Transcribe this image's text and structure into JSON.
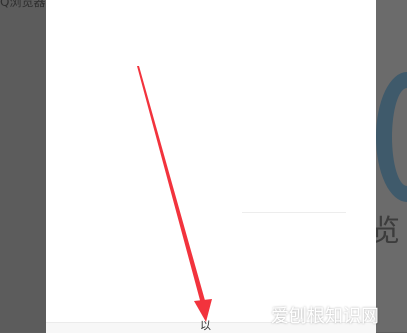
{
  "background": {
    "window_title_fragment": "Q浏览器",
    "side_text_fragment": "览"
  },
  "dialog": {
    "footer_glyph": "以"
  },
  "annotation": {
    "type": "red-arrow",
    "color": "#f2333d"
  },
  "watermark": {
    "text": "爱刨根知识网"
  }
}
